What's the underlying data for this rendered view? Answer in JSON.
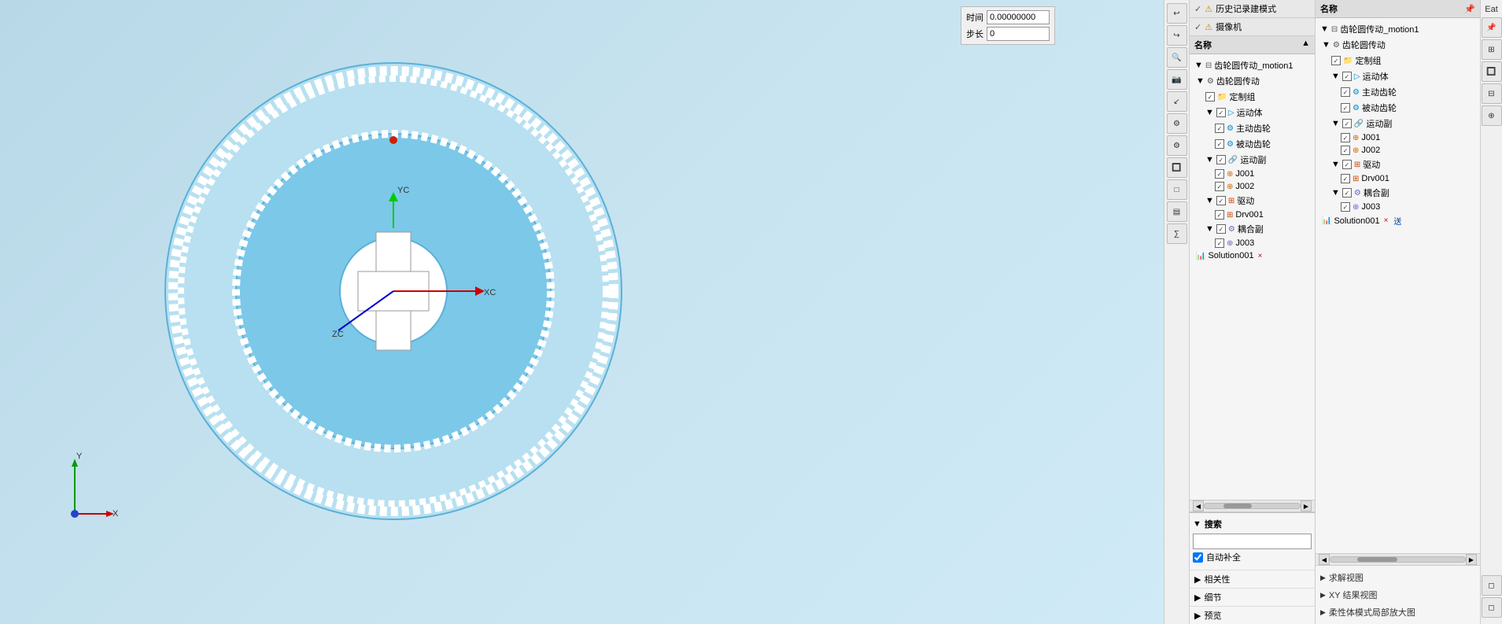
{
  "viewport": {
    "background": "#c8e4f0"
  },
  "simulation": {
    "time_label": "时间",
    "time_value": "0.00000000",
    "step_label": "步长",
    "step_value": "0",
    "history_mode": "历史记录建模式",
    "camera": "摄像机"
  },
  "tree_panel": {
    "title": "名称",
    "expand_icon": "▲",
    "items": [
      {
        "id": "root",
        "label": "齿轮圆传动_motion1",
        "level": 0,
        "checked": true,
        "icon": "⚙",
        "expanded": true
      },
      {
        "id": "gear_trans",
        "label": "齿轮圆传动",
        "level": 1,
        "checked": true,
        "icon": "⚙",
        "expanded": true
      },
      {
        "id": "custom",
        "label": "定制组",
        "level": 2,
        "checked": true,
        "icon": "📁",
        "expanded": false
      },
      {
        "id": "motion_body",
        "label": "运动体",
        "level": 2,
        "checked": true,
        "icon": "▷",
        "expanded": true
      },
      {
        "id": "drive_gear",
        "label": "主动齿轮",
        "level": 3,
        "checked": true,
        "icon": "⚙"
      },
      {
        "id": "driven_gear",
        "label": "被动齿轮",
        "level": 3,
        "checked": true,
        "icon": "⚙"
      },
      {
        "id": "motion_pair",
        "label": "运动副",
        "level": 2,
        "checked": true,
        "icon": "🔗",
        "expanded": true
      },
      {
        "id": "j001",
        "label": "J001",
        "level": 3,
        "checked": true,
        "icon": "🔗"
      },
      {
        "id": "j002",
        "label": "J002",
        "level": 3,
        "checked": true,
        "icon": "🔗"
      },
      {
        "id": "drive",
        "label": "驱动",
        "level": 2,
        "checked": true,
        "icon": "►",
        "expanded": true
      },
      {
        "id": "drv001",
        "label": "Drv001",
        "level": 3,
        "checked": true,
        "icon": "►"
      },
      {
        "id": "coupling",
        "label": "耦合副",
        "level": 2,
        "checked": true,
        "icon": "⚙",
        "expanded": true
      },
      {
        "id": "j003",
        "label": "J003",
        "level": 3,
        "checked": true,
        "icon": "⚙"
      },
      {
        "id": "solution001",
        "label": "Solution001",
        "level": 1,
        "checked": false,
        "icon": "📊"
      }
    ]
  },
  "props_panel": {
    "title": "名称",
    "pin_icon": "📌",
    "items": [
      {
        "id": "root",
        "label": "齿轮圆传动_motion1",
        "level": 0,
        "checked": true,
        "icon": "⚙",
        "expanded": true
      },
      {
        "id": "gear_trans",
        "label": "齿轮圆传动",
        "level": 1,
        "checked": true,
        "icon": "⚙",
        "expanded": true
      },
      {
        "id": "custom",
        "label": "定制组",
        "level": 2,
        "checked": true,
        "icon": "📁"
      },
      {
        "id": "motion_body",
        "label": "运动体",
        "level": 2,
        "checked": true,
        "icon": "▷",
        "expanded": true
      },
      {
        "id": "drive_gear",
        "label": "主动齿轮",
        "level": 3,
        "checked": true,
        "icon": "⚙"
      },
      {
        "id": "driven_gear",
        "label": "被动齿轮",
        "level": 3,
        "checked": true,
        "icon": "⚙"
      },
      {
        "id": "motion_pair",
        "label": "运动副",
        "level": 2,
        "checked": true,
        "icon": "🔗",
        "expanded": true
      },
      {
        "id": "j001",
        "label": "J001",
        "level": 3,
        "checked": true,
        "icon": "🔗"
      },
      {
        "id": "j002",
        "label": "J002",
        "level": 3,
        "checked": true,
        "icon": "🔗"
      },
      {
        "id": "drive",
        "label": "驱动",
        "level": 2,
        "checked": true,
        "icon": "►",
        "expanded": true
      },
      {
        "id": "drv001",
        "label": "Drv001",
        "level": 3,
        "checked": true,
        "icon": "►"
      },
      {
        "id": "coupling",
        "label": "耦合副",
        "level": 2,
        "checked": true,
        "icon": "⚙",
        "expanded": true
      },
      {
        "id": "j003",
        "label": "J003",
        "level": 3,
        "checked": true,
        "icon": "⚙"
      },
      {
        "id": "solution001",
        "label": "Solution001",
        "level": 1,
        "checked": false,
        "icon": "📊"
      }
    ],
    "bottom_links": [
      {
        "label": "求解视图",
        "icon": "▶"
      },
      {
        "label": "XY 结果视图",
        "icon": "▶"
      },
      {
        "label": "柔性体模式局部放大图",
        "icon": "▶"
      }
    ],
    "eat_label": "Eat"
  },
  "search_panel": {
    "collapse_icon": "▼",
    "search_label": "搜索",
    "search_placeholder": "",
    "autocomplete_label": "自动补全",
    "sections": [
      {
        "label": "相关性",
        "icon": "▶"
      },
      {
        "label": "细节",
        "icon": "▶"
      },
      {
        "label": "预览",
        "icon": "▶"
      }
    ]
  },
  "toolbar_left": {
    "buttons": [
      "↩",
      "↪",
      "🔍",
      "📷",
      "↙",
      "⚙",
      "⚙",
      "🔲",
      "🔲",
      "▤",
      "∑"
    ]
  },
  "toolbar_right": {
    "buttons": [
      "📌",
      "⊞",
      "🔲",
      "⊟",
      "⊕"
    ]
  },
  "coord_labels": {
    "x": "X",
    "y": "Y",
    "xc": "XC",
    "yc": "YC",
    "zc": "ZC"
  }
}
